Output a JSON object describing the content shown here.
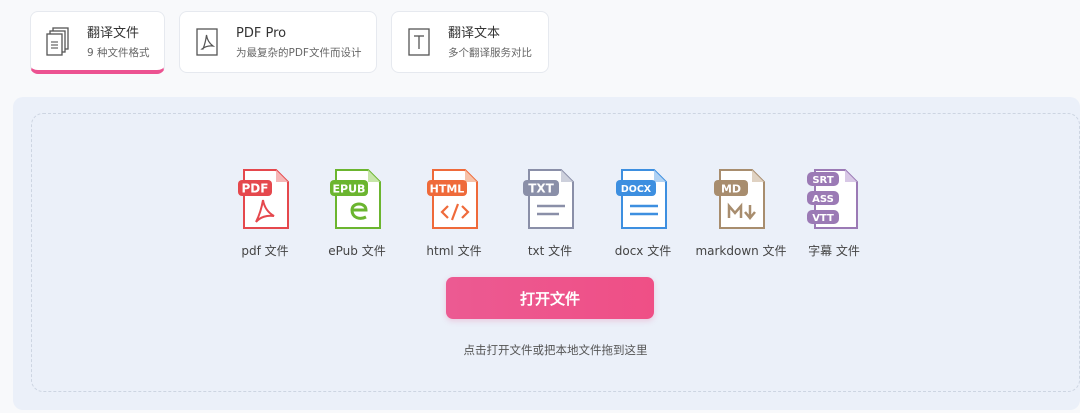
{
  "tabs": [
    {
      "title": "翻译文件",
      "subtitle": "9 种文件格式",
      "icon": "documents-icon",
      "active": true
    },
    {
      "title": "PDF Pro",
      "subtitle": "为最复杂的PDF文件而设计",
      "icon": "pdf-acrobat-icon",
      "active": false
    },
    {
      "title": "翻译文本",
      "subtitle": "多个翻译服务对比",
      "icon": "text-file-icon",
      "active": false
    }
  ],
  "formats": [
    {
      "badge": "PDF",
      "label": "pdf 文件",
      "color": "#e5484d",
      "icon": "pdf-file-icon"
    },
    {
      "badge": "EPUB",
      "label": "ePub 文件",
      "color": "#6bb52f",
      "icon": "epub-file-icon"
    },
    {
      "badge": "HTML",
      "label": "html 文件",
      "color": "#ef6a3a",
      "icon": "html-file-icon"
    },
    {
      "badge": "TXT",
      "label": "txt 文件",
      "color": "#8a8fa8",
      "icon": "txt-file-icon"
    },
    {
      "badge": "DOCX",
      "label": "docx 文件",
      "color": "#3d8fe0",
      "icon": "docx-file-icon"
    },
    {
      "badge": "MD",
      "label": "markdown 文件",
      "color": "#a88d6e",
      "icon": "markdown-file-icon"
    },
    {
      "badges": [
        "SRT",
        "ASS",
        "VTT"
      ],
      "label": "字幕 文件",
      "color": "#9b7ab5",
      "icon": "subtitle-file-icon"
    }
  ],
  "open_button": "打开文件",
  "hint": "点击打开文件或把本地文件拖到这里",
  "colors": {
    "accent": "#ec5291",
    "panel_bg": "#ebf0f9"
  }
}
